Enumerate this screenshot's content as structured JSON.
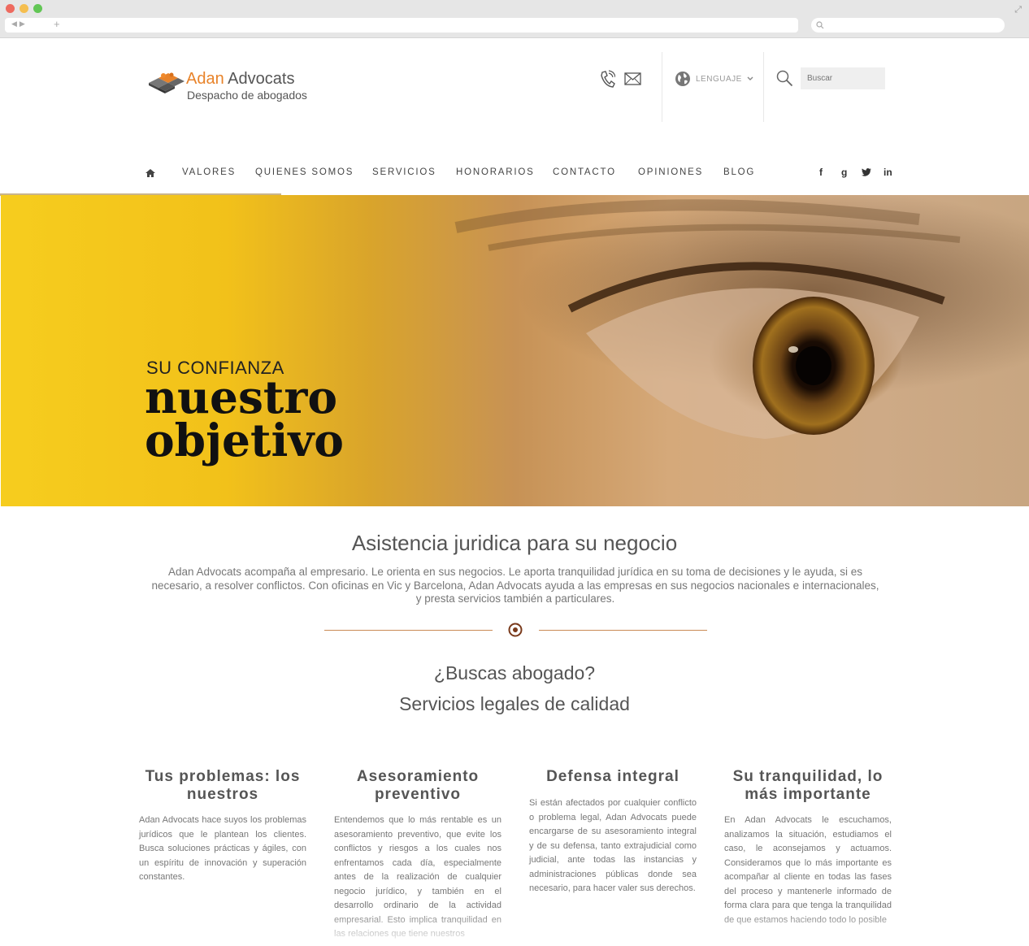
{
  "brand": {
    "name_part1": "Adan",
    "name_part2": "Advocats",
    "tagline": "Despacho de abogados",
    "accent": "#e8832a"
  },
  "header": {
    "language_label": "LENGUAJE",
    "search_placeholder": "Buscar"
  },
  "nav": {
    "home_icon": "home-icon",
    "items": [
      "VALORES",
      "QUIENES SOMOS",
      "SERVICIOS",
      "HONORARIOS",
      "CONTACTO",
      "OPINIONES",
      "BLOG"
    ],
    "social": [
      "f",
      "g",
      "t",
      "in"
    ]
  },
  "hero": {
    "subtitle": "SU CONFIANZA",
    "title_line1": "nuestro",
    "title_line2": "objetivo"
  },
  "intro": {
    "title": "Asistencia juridica para su negocio",
    "text": "Adan Advocats acompaña al empresario. Le orienta en sus negocios. Le aporta tranquilidad jurídica en su toma de decisiones y le ayuda, si es necesario, a resolver conflictos. Con oficinas en Vic y Barcelona, Adan Advocats ayuda a las empresas en sus negocios nacionales e internacionales, y presta servicios también a particulares."
  },
  "services": {
    "question": "¿Buscas abogado?",
    "subtitle": "Servicios legales de calidad",
    "columns": [
      {
        "title": "Tus problemas: los nuestros",
        "text": "Adan Advocats hace suyos los problemas jurídicos que le plantean los clientes. Busca soluciones prácticas y ágiles, con un espíritu de innovación y superación constantes."
      },
      {
        "title": "Asesoramiento preventivo",
        "text": "Entendemos que lo más rentable es un asesoramiento preventivo, que evite los conflictos y riesgos a los cuales nos enfrentamos cada día, especialmente antes de la realización de cualquier negocio jurídico, y también en el desarrollo ordinario de la actividad empresarial. Esto implica tranquilidad en las relaciones que tiene nuestros"
      },
      {
        "title": "Defensa integral",
        "text": "Si están afectados por cualquier conflicto o problema legal, Adan Advocats puede encargarse de su asesoramiento integral y de su defensa, tanto extrajudicial como judicial, ante todas las instancias y administraciones públicas donde sea necesario, para hacer valer sus derechos."
      },
      {
        "title": "Su tranquilidad, lo más importante",
        "text": "En Adan Advocats le escuchamos, analizamos la situación, estudiamos el caso, le aconsejamos y actuamos. Consideramos que lo más importante es acompañar al cliente en todas las fases del proceso y mantenerle informado de forma clara para que tenga la tranquilidad de que estamos haciendo todo lo posible"
      }
    ]
  }
}
